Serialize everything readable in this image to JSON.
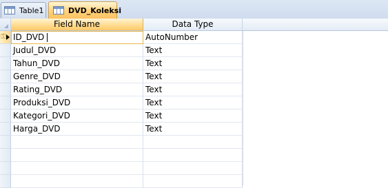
{
  "tabs": [
    {
      "label": "Table1",
      "active": false,
      "icon": "table-icon"
    },
    {
      "label": "DVD_Koleksi",
      "active": true,
      "icon": "table-icon"
    }
  ],
  "grid": {
    "headers": {
      "field_name": "Field Name",
      "data_type": "Data Type"
    },
    "rows": [
      {
        "field": "ID_DVD",
        "type": "AutoNumber",
        "primary_key": true,
        "current": true
      },
      {
        "field": "Judul_DVD",
        "type": "Text"
      },
      {
        "field": "Tahun_DVD",
        "type": "Text"
      },
      {
        "field": "Genre_DVD",
        "type": "Text"
      },
      {
        "field": "Rating_DVD",
        "type": "Text"
      },
      {
        "field": "Produksi_DVD",
        "type": "Text"
      },
      {
        "field": "Kategori_DVD",
        "type": "Text"
      },
      {
        "field": "Harga_DVD",
        "type": "Text"
      }
    ],
    "empty_rows": 4
  },
  "colors": {
    "active_tab": "#ffd27a",
    "header_highlight": "#ffd98c",
    "grid_line": "#d6deea"
  }
}
